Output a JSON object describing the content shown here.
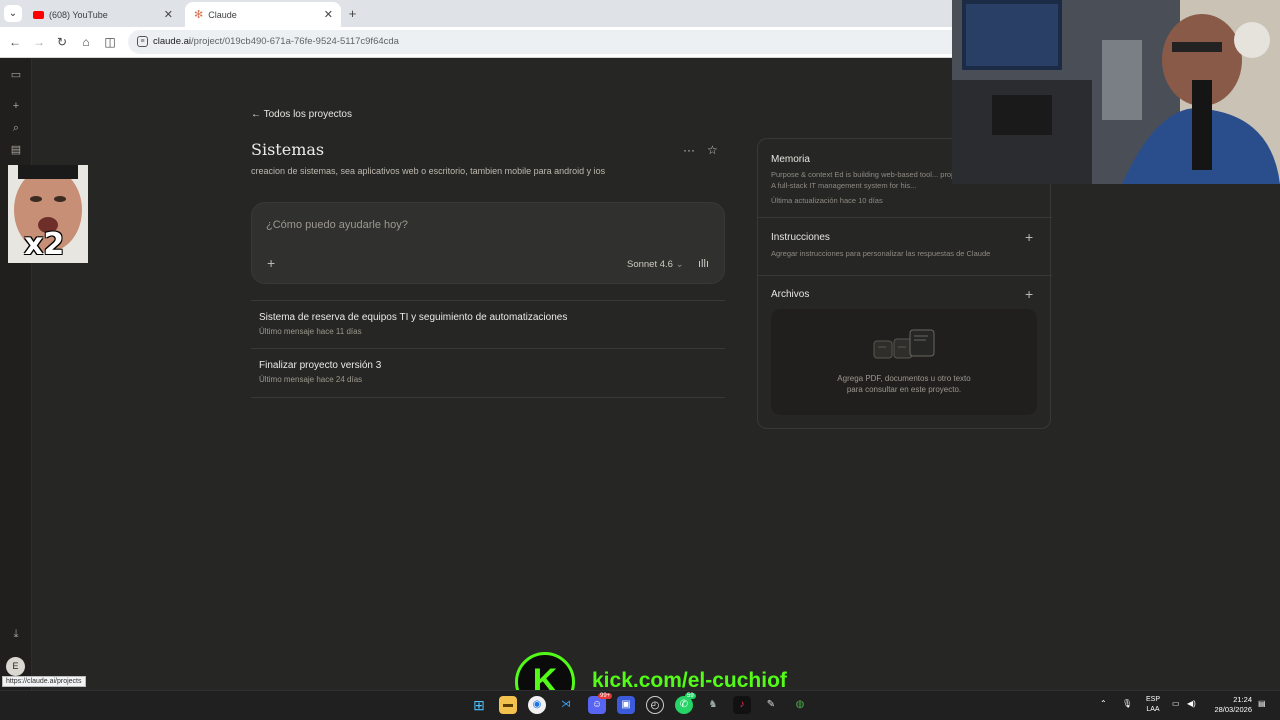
{
  "browser": {
    "tabs": [
      {
        "title": "(608) YouTube",
        "active": false,
        "favicon_color": "#ff0000"
      },
      {
        "title": "Claude",
        "active": true,
        "favicon_color": "#d97757"
      }
    ],
    "url_domain": "claude.ai",
    "url_path": "/project/019cb490-671a-76fe-9524-5117c9f64cda",
    "status_url": "https://claude.ai/projects"
  },
  "sidebar": {
    "avatar_initial": "E"
  },
  "project": {
    "back_label": "Todos los proyectos",
    "title": "Sistemas",
    "description": "creacion de sistemas, sea aplicativos web o escritorio, tambien mobile para android y ios"
  },
  "composer": {
    "placeholder": "¿Cómo puedo ayudarle hoy?",
    "model": "Sonnet 4.6"
  },
  "conversations": [
    {
      "title": "Sistema de reserva de equipos TI y seguimiento de automatizaciones",
      "subtitle": "Último mensaje hace 11 días"
    },
    {
      "title": "Finalizar proyecto versión 3",
      "subtitle": "Último mensaje hace 24 días"
    }
  ],
  "panel": {
    "memory": {
      "title": "Memoria",
      "preview": "Purpose & context Ed is building web-based tool... projects: IT Hub – A full-stack IT management system for his...",
      "updated": "Última actualización hace 10 días"
    },
    "instructions": {
      "title": "Instrucciones",
      "hint": "Agregar instrucciones para personalizar las respuestas de Claude"
    },
    "files": {
      "title": "Archivos",
      "empty_line1": "Agrega PDF, documentos u otro texto",
      "empty_line2": "para consultar en este proyecto."
    }
  },
  "overlay": {
    "badge": "x2",
    "kick_letter": "K",
    "kick_url": "kick.com/el-cuchiof"
  },
  "taskbar": {
    "badge_discord": "99+",
    "badge_whatsapp": "59",
    "lang_line1": "ESP",
    "lang_line2": "LAA",
    "time": "21:24",
    "date": "28/03/2026"
  }
}
